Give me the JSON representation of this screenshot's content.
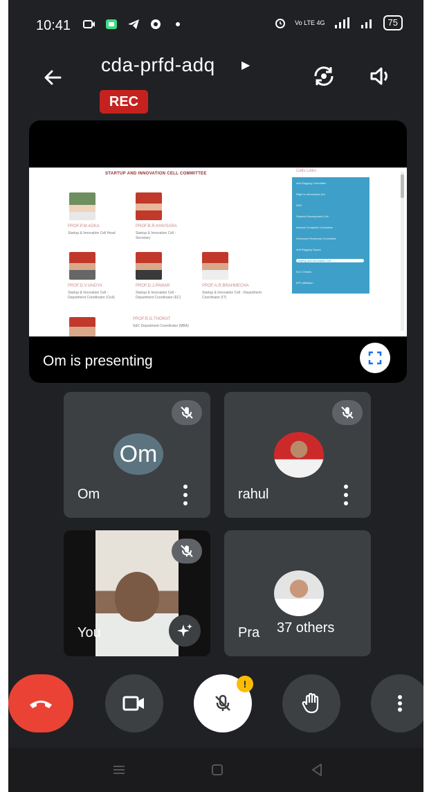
{
  "status_bar": {
    "time": "10:41",
    "battery": "75",
    "network_label": "Vo LTE 4G"
  },
  "header": {
    "meeting_code": "cda-prfd-adq",
    "rec_label": "REC"
  },
  "presentation": {
    "presenting_text": "Om is presenting",
    "slide": {
      "title": "STARTUP AND INNOVATION CELL COMMITTEE",
      "side_menu_title": "Cells Links",
      "menu_items": [
        "Anti Ragging Committee",
        "Right to Information Act",
        "NSS",
        "Student Development Cell",
        "Internal Complaint Committee",
        "Grievance Redressal Committee",
        "Anti Ragging Squad",
        "Startup and Innovation Cell",
        "NCC Details",
        "IIPS Affiliation"
      ],
      "people": [
        {
          "name": "PROF.P.M.ADKA",
          "role": "Startup & Innovation Cell Head"
        },
        {
          "name": "PROF.B.R.KHIVSARA",
          "role": "Startup & Innovation Cell - Secretary"
        },
        {
          "name": "PROF.D.V.VAIDYA",
          "role": "Startup & Innovation Cell - Department Coordinator (Civil)"
        },
        {
          "name": "PROF.D.J.PAWAR",
          "role": "Startup & Innovation Cell - Department Coordinator (EC)"
        },
        {
          "name": "PROF.A.R.BRAHMECHA",
          "role": "Startup & Innovation Cell - Department Coordinator (IT)"
        },
        {
          "name": "PROF.R.G.THORAT",
          "role": "S&C Department Coordinator (MBA)"
        }
      ]
    }
  },
  "participants": [
    {
      "name": "Om",
      "initials": "Om"
    },
    {
      "name": "rahul"
    },
    {
      "name": "You"
    },
    {
      "name": "Pra",
      "others": "37 others"
    }
  ],
  "controls": {
    "notification_badge": "!"
  },
  "colors": {
    "background": "#202124",
    "tile": "#3c4043",
    "rec": "#c5221f",
    "end_call": "#ea4335",
    "badge": "#fbbc04",
    "slide_menu": "#3ea0c8"
  }
}
